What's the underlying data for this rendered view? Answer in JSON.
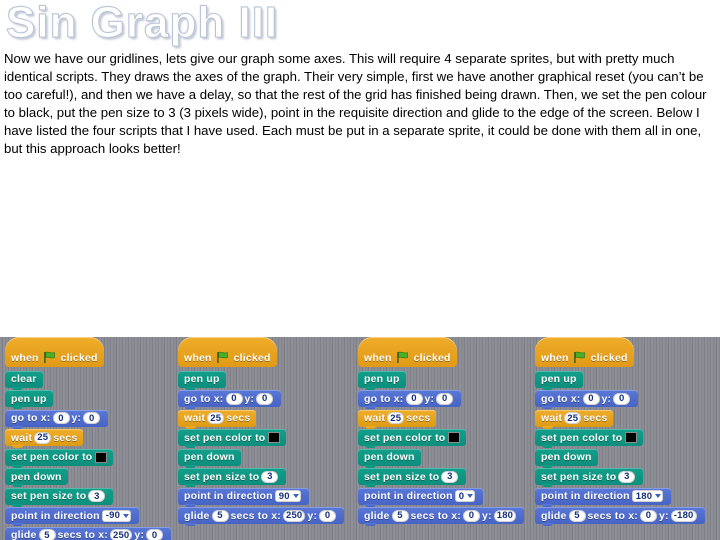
{
  "slide": {
    "title": "Sin Graph III",
    "body": "Now we have our gridlines, lets give our graph some axes.  This will require 4 separate sprites, but with pretty much identical scripts.  They draws the axes of the graph.  Their very simple, first we have another graphical reset (you can’t be too careful!), and then we have a delay, so that the rest of the grid has finished being drawn.  Then, we set the pen colour to black, put the pen size to 3 (3 pixels wide), point in the requisite direction and glide to the edge of the screen.  Below I have listed the four scripts that I have used.  Each must be put in a separate sprite, it could be done with them all in one, but this approach looks better!"
  },
  "palette": {
    "hat_yellow": "#f0ad2a",
    "pen_green": "#12a08a",
    "motion_blue": "#5a78d8",
    "control_orange": "#f0ad2a",
    "panel_grey": "#8c8c94",
    "pen_color_value": "#000000"
  },
  "labels": {
    "when": "when",
    "clicked": "clicked",
    "clear": "clear",
    "pen_up": "pen up",
    "pen_down": "pen down",
    "go_to": "go to x:",
    "y_label": "y:",
    "wait": "wait",
    "secs": "secs",
    "set_pen_color": "set pen color to",
    "set_pen_size": "set pen size to",
    "point_in_direction": "point in direction",
    "glide": "glide",
    "glide_secs_to_x": "secs to x:"
  },
  "scripts": [
    {
      "name": "script-1-left-axis",
      "has_clear": true,
      "clear_label": "clear",
      "go_to_x": "0",
      "go_to_y": "0",
      "wait_secs": "25",
      "pen_size": "3",
      "direction": "-90",
      "glide_secs": "5",
      "glide_x": "250",
      "glide_y": "0"
    },
    {
      "name": "script-2-right-axis",
      "has_clear": false,
      "clear_label": "",
      "go_to_x": "0",
      "go_to_y": "0",
      "wait_secs": "25",
      "pen_size": "3",
      "direction": "90",
      "glide_secs": "5",
      "glide_x": "250",
      "glide_y": "0"
    },
    {
      "name": "script-3-up-axis",
      "has_clear": false,
      "clear_label": "",
      "go_to_x": "0",
      "go_to_y": "0",
      "wait_secs": "25",
      "pen_size": "3",
      "direction": "0",
      "glide_secs": "5",
      "glide_x": "0",
      "glide_y": "180"
    },
    {
      "name": "script-4-down-axis",
      "has_clear": false,
      "clear_label": "",
      "go_to_x": "0",
      "go_to_y": "0",
      "wait_secs": "25",
      "pen_size": "3",
      "direction": "180",
      "glide_secs": "5",
      "glide_x": "0",
      "glide_y": "-180"
    }
  ]
}
